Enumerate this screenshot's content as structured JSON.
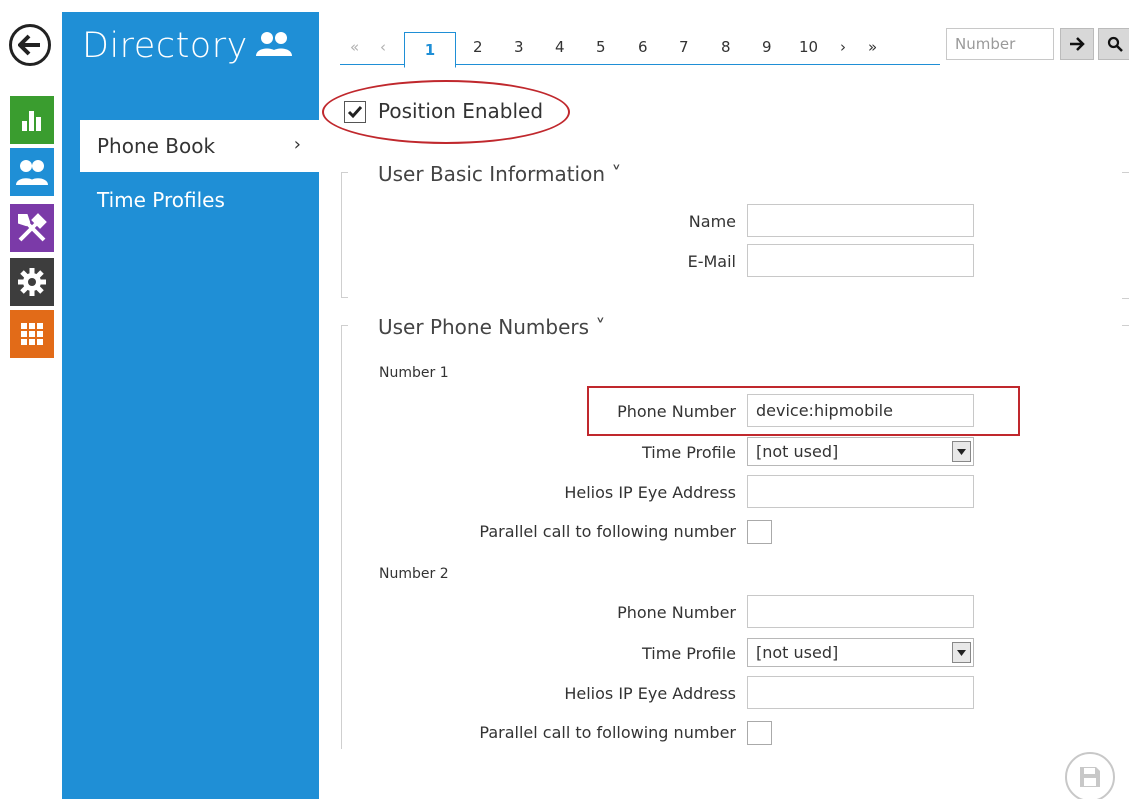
{
  "sidebar": {
    "title": "Directory",
    "items": [
      {
        "label": "Phone Book",
        "chevron": "›",
        "active": true
      },
      {
        "label": "Time Profiles",
        "active": false
      }
    ]
  },
  "rail": {
    "icons": [
      "back-arrow-icon",
      "status-chart-icon",
      "directory-users-icon",
      "hardware-tools-icon",
      "services-gear-icon",
      "system-grid-icon"
    ],
    "colors": {
      "status": "#3a9d2f",
      "directory": "#1f8fd6",
      "hardware": "#7b3aa8",
      "services": "#3d3d3d",
      "system": "#e26b18"
    }
  },
  "pager": {
    "first": "«",
    "prev": "‹",
    "current": "1",
    "pages": [
      "2",
      "3",
      "4",
      "5",
      "6",
      "7",
      "8",
      "9",
      "10"
    ],
    "next": "›",
    "last": "»",
    "number_placeholder": "Number"
  },
  "position": {
    "label": "Position Enabled",
    "checked": true
  },
  "basic_info": {
    "title": "User Basic Information ˅",
    "name_label": "Name",
    "email_label": "E-Mail",
    "name_value": "",
    "email_value": ""
  },
  "phone_numbers": {
    "title": "User Phone Numbers ˅",
    "numbers": [
      {
        "group_label": "Number 1",
        "phone_label": "Phone Number",
        "phone_value": "device:hipmobile",
        "time_profile_label": "Time Profile",
        "time_profile_value": "[not used]",
        "eye_label": "Helios IP Eye Address",
        "eye_value": "",
        "parallel_label": "Parallel call to following number",
        "parallel_checked": false
      },
      {
        "group_label": "Number 2",
        "phone_label": "Phone Number",
        "phone_value": "",
        "time_profile_label": "Time Profile",
        "time_profile_value": "[not used]",
        "eye_label": "Helios IP Eye Address",
        "eye_value": "",
        "parallel_label": "Parallel call to following number",
        "parallel_checked": false
      }
    ]
  },
  "accent_color": "#1f8fd6",
  "highlight_color": "#c0282d"
}
